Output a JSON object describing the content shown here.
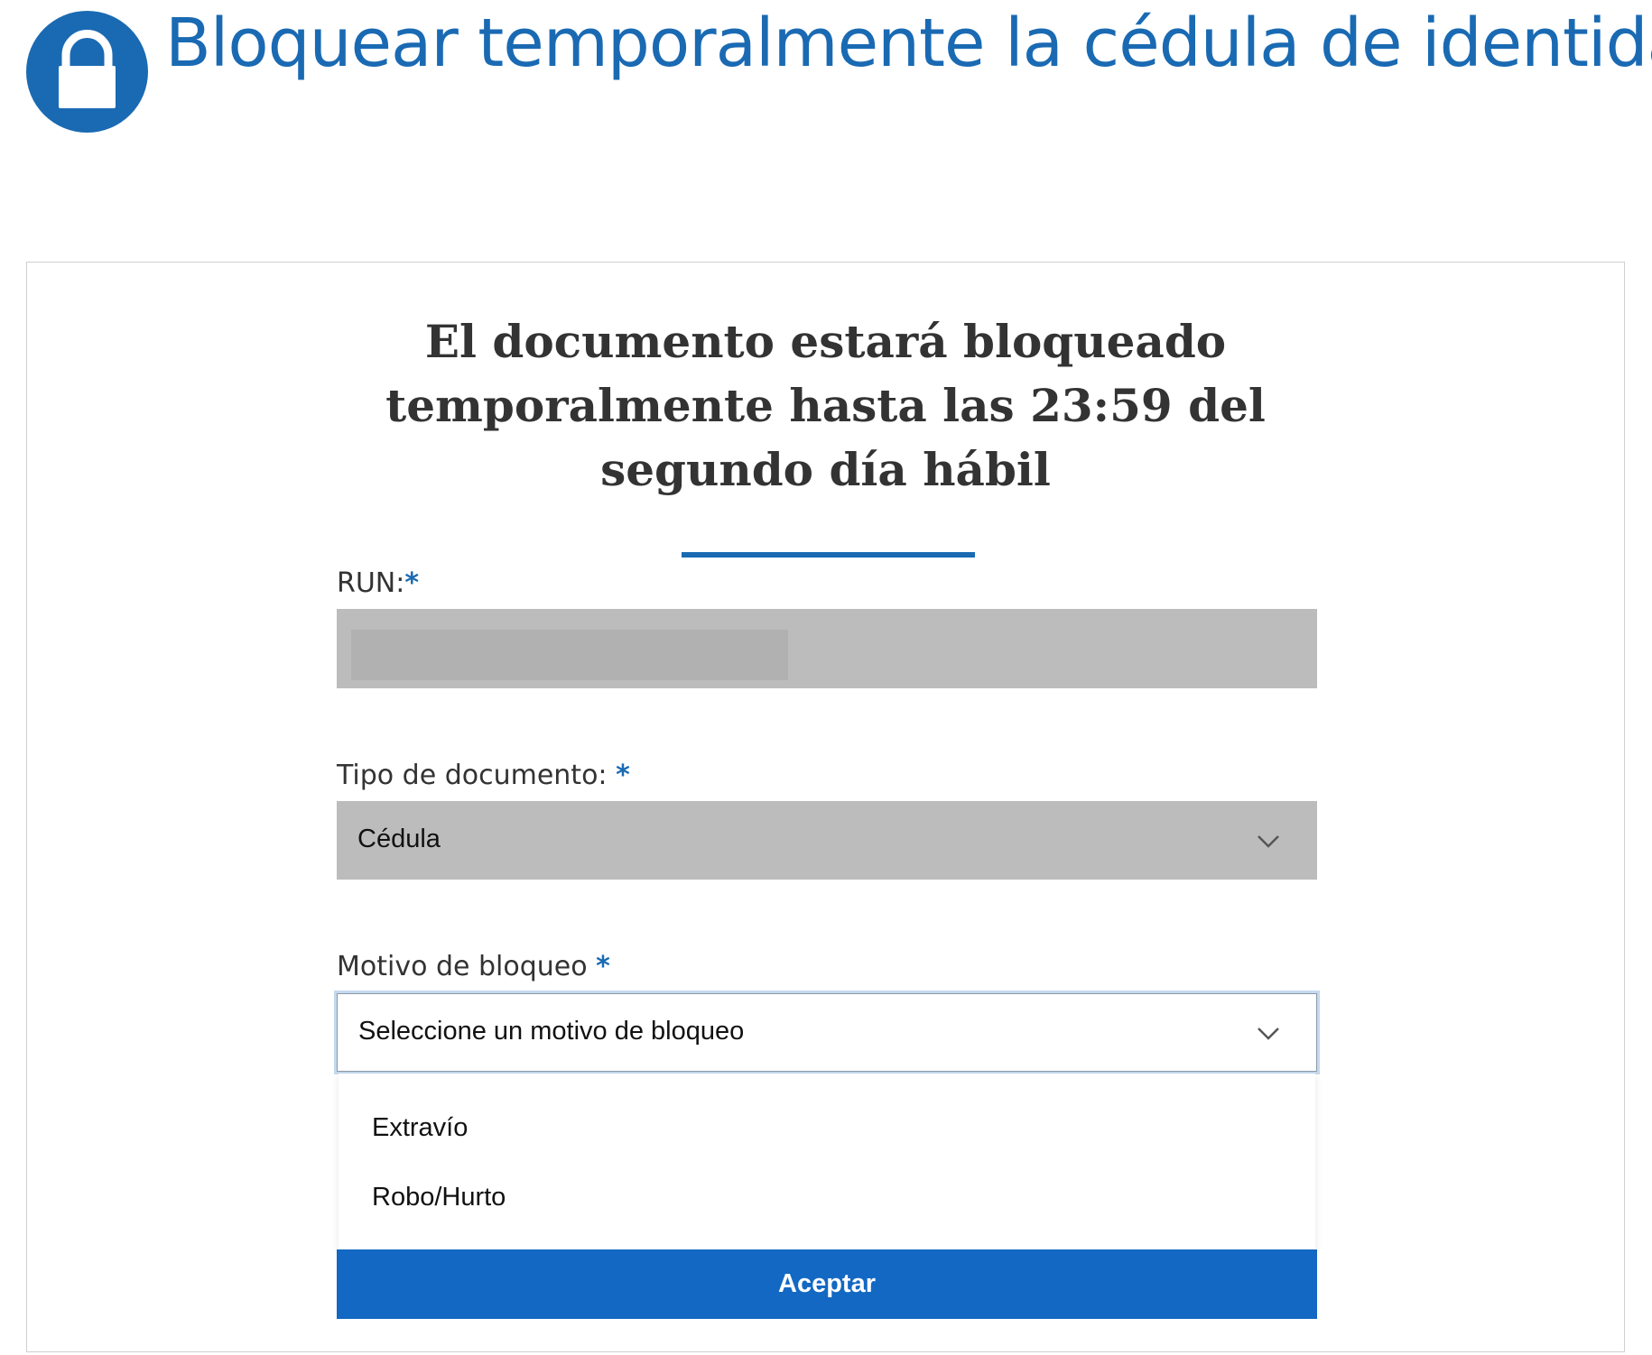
{
  "header": {
    "title": "Bloquear temporalmente la cédula de identidad",
    "icon": "lock-icon",
    "accent_color": "#1a6ab3"
  },
  "card": {
    "title_lines": [
      "El documento estará bloqueado",
      "temporalmente hasta las 23:59 del",
      "segundo día hábil"
    ]
  },
  "form": {
    "run": {
      "label": "RUN:",
      "required_mark": "*",
      "value": ""
    },
    "document_type": {
      "label": "Tipo de documento:",
      "required_mark": "*",
      "selected": "Cédula"
    },
    "block_reason": {
      "label": "Motivo de bloqueo",
      "required_mark": "*",
      "placeholder": "Seleccione un motivo de bloqueo",
      "options": [
        "Extravío",
        "Robo/Hurto"
      ]
    },
    "submit_label": "Aceptar"
  },
  "colors": {
    "primary_button": "#1268c3",
    "disabled_field": "#bcbcbc"
  }
}
